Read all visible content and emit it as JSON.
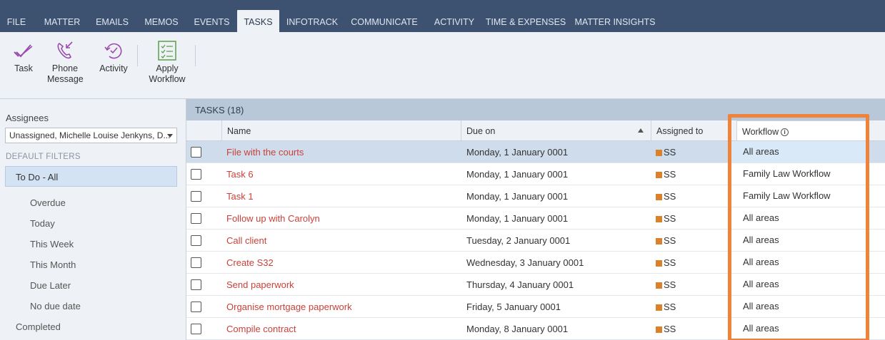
{
  "topbar": {
    "tabs": [
      {
        "label": "FILE",
        "active": false
      },
      {
        "label": "MATTER",
        "active": false
      },
      {
        "label": "EMAILS",
        "active": false
      },
      {
        "label": "MEMOS",
        "active": false
      },
      {
        "label": "EVENTS",
        "active": false
      },
      {
        "label": "TASKS",
        "active": true
      },
      {
        "label": "INFOTRACK",
        "active": false
      },
      {
        "label": "COMMUNICATE",
        "active": false
      },
      {
        "label": "ACTIVITY",
        "active": false
      },
      {
        "label": "TIME & EXPENSES",
        "active": false
      },
      {
        "label": "MATTER INSIGHTS",
        "active": false
      }
    ]
  },
  "ribbon": {
    "task_label": "Task",
    "phone_label_1": "Phone",
    "phone_label_2": "Message",
    "activity_label": "Activity",
    "workflow_label_1": "Apply",
    "workflow_label_2": "Workflow",
    "icon_color_purple": "#9b4bb0",
    "icon_color_green": "#5aa04a"
  },
  "left": {
    "assignees_label": "Assignees",
    "assignees_value": "Unassigned, Michelle Louise Jenkyns, D...",
    "section_label": "DEFAULT FILTERS",
    "filters": [
      {
        "label": "To Do - All",
        "selected": true
      },
      {
        "label": "Overdue"
      },
      {
        "label": "Today"
      },
      {
        "label": "This Week"
      },
      {
        "label": "This Month"
      },
      {
        "label": "Due Later"
      },
      {
        "label": "No due date"
      },
      {
        "label": "Completed"
      }
    ]
  },
  "grid": {
    "title": "TASKS (18)",
    "columns": {
      "name": "Name",
      "due": "Due on",
      "assigned": "Assigned to",
      "workflow": "Workflow"
    },
    "rows": [
      {
        "name": "File with the courts",
        "due": "Monday, 1 January 0001",
        "assigned": "SS",
        "workflow": "All areas"
      },
      {
        "name": "Task 6",
        "due": "Monday, 1 January 0001",
        "assigned": "SS",
        "workflow": "Family Law Workflow"
      },
      {
        "name": "Task 1",
        "due": "Monday, 1 January 0001",
        "assigned": "SS",
        "workflow": "Family Law Workflow"
      },
      {
        "name": "Follow up with Carolyn",
        "due": "Monday, 1 January 0001",
        "assigned": "SS",
        "workflow": "All areas"
      },
      {
        "name": "Call client",
        "due": "Tuesday, 2 January 0001",
        "assigned": "SS",
        "workflow": "All areas"
      },
      {
        "name": "Create S32",
        "due": "Wednesday, 3 January 0001",
        "assigned": "SS",
        "workflow": "All areas"
      },
      {
        "name": "Send paperwork",
        "due": "Thursday, 4 January 0001",
        "assigned": "SS",
        "workflow": "All areas"
      },
      {
        "name": "Organise mortgage paperwork",
        "due": "Friday, 5 January 0001",
        "assigned": "SS",
        "workflow": "All areas"
      },
      {
        "name": "Compile contract",
        "due": "Monday, 8 January 0001",
        "assigned": "SS",
        "workflow": "All areas"
      }
    ],
    "highlight_color": "#f0833a",
    "task_name_color": "#c8423a"
  }
}
